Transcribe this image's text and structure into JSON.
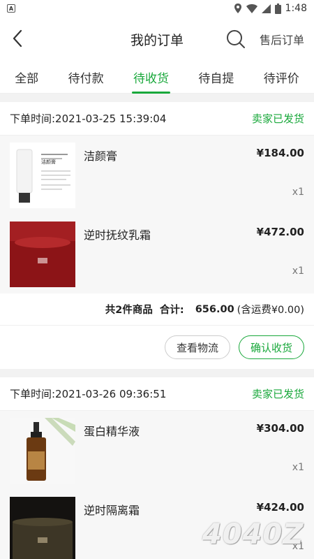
{
  "status_bar": {
    "time": "1:48",
    "app_icon": "A"
  },
  "header": {
    "title": "我的订单",
    "after_sale": "售后订单"
  },
  "tabs": [
    {
      "label": "全部",
      "active": false
    },
    {
      "label": "待付款",
      "active": false
    },
    {
      "label": "待收货",
      "active": true
    },
    {
      "label": "待自提",
      "active": false
    },
    {
      "label": "待评价",
      "active": false
    }
  ],
  "orders": [
    {
      "time": "下单时间:2021-03-25 15:39:04",
      "status": "卖家已发货",
      "items": [
        {
          "name": "洁颜膏",
          "price": "¥184.00",
          "qty": "x1",
          "thumb_text": "洁颜膏"
        },
        {
          "name": "逆时抚纹乳霜",
          "price": "¥472.00",
          "qty": "x1"
        }
      ],
      "summary": {
        "count": "共2件商品",
        "total_label": "合计:",
        "total": "656.00",
        "shipping": "(含运费¥0.00)"
      },
      "buttons": {
        "logistics": "查看物流",
        "confirm": "确认收货"
      }
    },
    {
      "time": "下单时间:2021-03-26 09:36:51",
      "status": "卖家已发货",
      "items": [
        {
          "name": "蛋白精华液",
          "price": "¥304.00",
          "qty": "x1"
        },
        {
          "name": "逆时隔离霜",
          "price": "¥424.00",
          "qty": "x1"
        }
      ]
    }
  ],
  "watermark": "4040Z",
  "colors": {
    "accent": "#19a83b"
  }
}
